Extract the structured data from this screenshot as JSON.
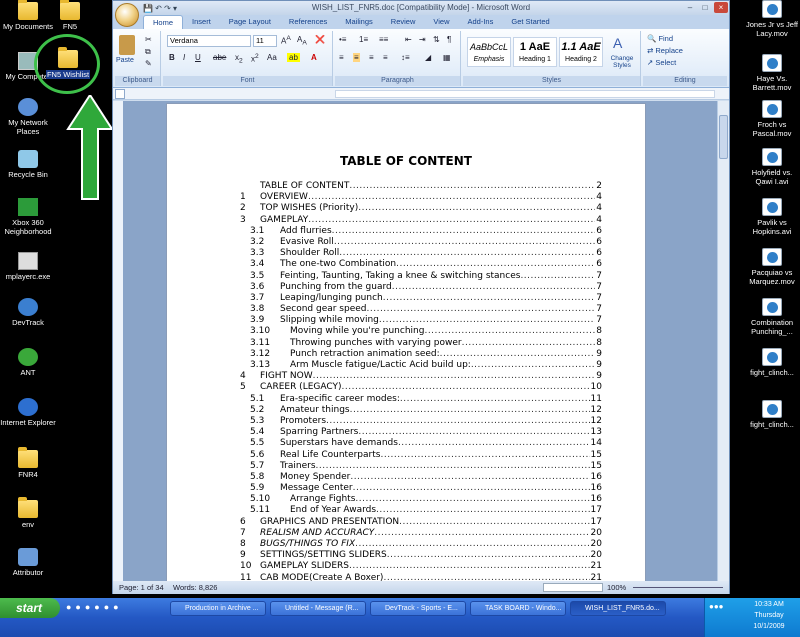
{
  "window": {
    "title": "WISH_LIST_FNR5.doc [Compatibility Mode] - Microsoft Word",
    "tabs": [
      "Home",
      "Insert",
      "Page Layout",
      "References",
      "Mailings",
      "Review",
      "View",
      "Add-Ins",
      "Get Started"
    ]
  },
  "ribbon": {
    "clipboard": {
      "label": "Clipboard",
      "paste": "Paste"
    },
    "font": {
      "label": "Font",
      "name": "Verdana",
      "size": "11"
    },
    "paragraph": {
      "label": "Paragraph"
    },
    "styles": {
      "label": "Styles",
      "items": [
        {
          "preview": "AaBbCcL",
          "name": "Emphasis"
        },
        {
          "preview": "1 AaE",
          "name": "Heading 1"
        },
        {
          "preview": "1.1 AaE",
          "name": "Heading 2"
        }
      ],
      "change": "Change Styles"
    },
    "editing": {
      "label": "Editing",
      "find": "Find",
      "replace": "Replace",
      "select": "Select"
    }
  },
  "document": {
    "title": "TABLE OF CONTENT",
    "toc": [
      {
        "num": "",
        "title": "TABLE OF CONTENT",
        "page": "2",
        "level": 1
      },
      {
        "num": "1",
        "title": "OVERVIEW",
        "page": "4",
        "level": 1
      },
      {
        "num": "2",
        "title": "TOP WISHES (Priority)",
        "page": "4",
        "level": 1
      },
      {
        "num": "3",
        "title": "GAMEPLAY",
        "page": "4",
        "level": 1
      },
      {
        "num": "3.1",
        "title": "Add flurries",
        "page": "6",
        "level": 2
      },
      {
        "num": "3.2",
        "title": "Evasive Roll",
        "page": "6",
        "level": 2
      },
      {
        "num": "3.3",
        "title": "Shoulder Roll",
        "page": "6",
        "level": 2
      },
      {
        "num": "3.4",
        "title": "The one-two Combination",
        "page": "6",
        "level": 2
      },
      {
        "num": "3.5",
        "title": "Feinting, Taunting, Taking a knee & switching stances",
        "page": "7",
        "level": 2
      },
      {
        "num": "3.6",
        "title": "Punching from the guard",
        "page": "7",
        "level": 2
      },
      {
        "num": "3.7",
        "title": "Leaping/lunging punch",
        "page": "7",
        "level": 2
      },
      {
        "num": "3.8",
        "title": "Second gear speed",
        "page": "7",
        "level": 2
      },
      {
        "num": "3.9",
        "title": "Slipping while moving",
        "page": "7",
        "level": 2
      },
      {
        "num": "3.10",
        "title": "Moving while you're punching",
        "page": "8",
        "level": 3
      },
      {
        "num": "3.11",
        "title": "Throwing punches with varying power",
        "page": "8",
        "level": 3
      },
      {
        "num": "3.12",
        "title": "Punch retraction animation seed:",
        "page": "9",
        "level": 3
      },
      {
        "num": "3.13",
        "title": "Arm Muscle fatigue/Lactic Acid build up:",
        "page": "9",
        "level": 3
      },
      {
        "num": "4",
        "title": "FIGHT NOW",
        "page": "9",
        "level": 1
      },
      {
        "num": "5",
        "title": "CAREER (LEGACY)",
        "page": "10",
        "level": 1
      },
      {
        "num": "5.1",
        "title": "Era-specific career modes:",
        "page": "11",
        "level": 2
      },
      {
        "num": "5.2",
        "title": "Amateur things",
        "page": "12",
        "level": 2
      },
      {
        "num": "5.3",
        "title": "Promoters",
        "page": "12",
        "level": 2
      },
      {
        "num": "5.4",
        "title": "Sparring Partners",
        "page": "13",
        "level": 2
      },
      {
        "num": "5.5",
        "title": "Superstars have demands",
        "page": "14",
        "level": 2
      },
      {
        "num": "5.6",
        "title": "Real Life Counterparts",
        "page": "15",
        "level": 2
      },
      {
        "num": "5.7",
        "title": "Trainers",
        "page": "15",
        "level": 2
      },
      {
        "num": "5.8",
        "title": "Money Spender",
        "page": "16",
        "level": 2
      },
      {
        "num": "5.9",
        "title": "Message Center",
        "page": "16",
        "level": 2
      },
      {
        "num": "5.10",
        "title": "Arrange Fights",
        "page": "16",
        "level": 3
      },
      {
        "num": "5.11",
        "title": "End of Year Awards",
        "page": "17",
        "level": 3
      },
      {
        "num": "6",
        "title": "GRAPHICS AND PRESENTATION",
        "page": "17",
        "level": 1
      },
      {
        "num": "7",
        "title": "REALISM AND ACCURACY",
        "page": "20",
        "level": 1,
        "italic": true
      },
      {
        "num": "8",
        "title": "BUGS/THINGS TO FIX",
        "page": "20",
        "level": 1,
        "italic": true
      },
      {
        "num": "9",
        "title": "SETTINGS/SETTING SLIDERS",
        "page": "20",
        "level": 1
      },
      {
        "num": "10",
        "title": "GAMEPLAY SLIDERS",
        "page": "21",
        "level": 1
      },
      {
        "num": "11",
        "title": "CAB MODE(Create A Boxer)",
        "page": "21",
        "level": 1
      }
    ]
  },
  "status": {
    "page": "Page: 1 of 34",
    "words": "Words: 8,826",
    "zoom": "100%"
  },
  "desktop": {
    "left": [
      "My Documents",
      "FN5",
      "My Computer",
      "FN5 Wishlist",
      "My Network Places",
      "Recycle Bin",
      "Xbox 360 Neighborhood",
      "mplayerc.exe",
      "DevTrack",
      "ANT",
      "Internet Explorer",
      "FNR4",
      "env",
      "Attributor"
    ],
    "right": [
      "Jones Jr vs Jeff Lacy.mov",
      "Haye Vs. Barrett.mov",
      "Froch vs Pascal.mov",
      "Holyfield vs. Qawi I.avi",
      "Pavlik vs Hopkins.avi",
      "Pacquiao vs Marquez.mov",
      "Combination Punching_...",
      "fight_clinch...",
      "fight_clinch..."
    ]
  },
  "taskbar": {
    "start": "start",
    "tasks": [
      "Production in Archive ...",
      "Untitled - Message (R...",
      "DevTrack - Sports - E...",
      "TASK BOARD - Windo...",
      "WISH_LIST_FNR5.do..."
    ],
    "time": "10:33 AM",
    "day": "Thursday",
    "date": "10/1/2009"
  },
  "colors": {
    "highlight": "#3ec04a",
    "taskbar": "#2458c4"
  }
}
